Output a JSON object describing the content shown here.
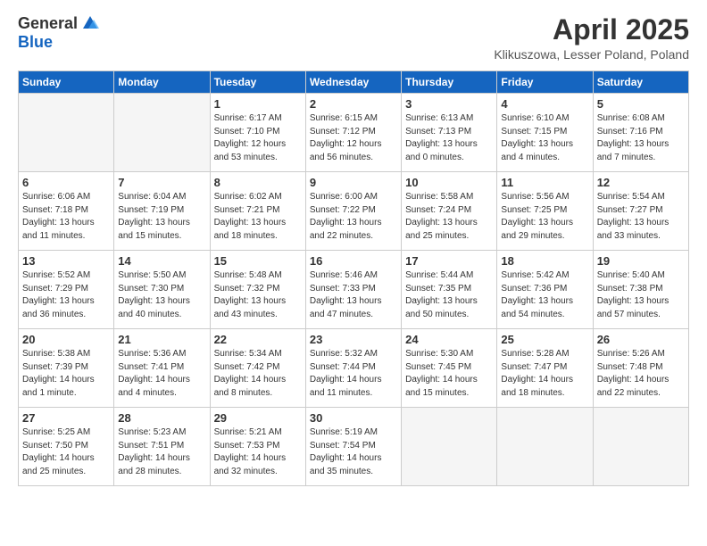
{
  "header": {
    "logo_general": "General",
    "logo_blue": "Blue",
    "title": "April 2025",
    "subtitle": "Klikuszowa, Lesser Poland, Poland"
  },
  "weekdays": [
    "Sunday",
    "Monday",
    "Tuesday",
    "Wednesday",
    "Thursday",
    "Friday",
    "Saturday"
  ],
  "weeks": [
    [
      {
        "day": "",
        "sunrise": "",
        "sunset": "",
        "daylight": ""
      },
      {
        "day": "",
        "sunrise": "",
        "sunset": "",
        "daylight": ""
      },
      {
        "day": "1",
        "sunrise": "Sunrise: 6:17 AM",
        "sunset": "Sunset: 7:10 PM",
        "daylight": "Daylight: 12 hours and 53 minutes."
      },
      {
        "day": "2",
        "sunrise": "Sunrise: 6:15 AM",
        "sunset": "Sunset: 7:12 PM",
        "daylight": "Daylight: 12 hours and 56 minutes."
      },
      {
        "day": "3",
        "sunrise": "Sunrise: 6:13 AM",
        "sunset": "Sunset: 7:13 PM",
        "daylight": "Daylight: 13 hours and 0 minutes."
      },
      {
        "day": "4",
        "sunrise": "Sunrise: 6:10 AM",
        "sunset": "Sunset: 7:15 PM",
        "daylight": "Daylight: 13 hours and 4 minutes."
      },
      {
        "day": "5",
        "sunrise": "Sunrise: 6:08 AM",
        "sunset": "Sunset: 7:16 PM",
        "daylight": "Daylight: 13 hours and 7 minutes."
      }
    ],
    [
      {
        "day": "6",
        "sunrise": "Sunrise: 6:06 AM",
        "sunset": "Sunset: 7:18 PM",
        "daylight": "Daylight: 13 hours and 11 minutes."
      },
      {
        "day": "7",
        "sunrise": "Sunrise: 6:04 AM",
        "sunset": "Sunset: 7:19 PM",
        "daylight": "Daylight: 13 hours and 15 minutes."
      },
      {
        "day": "8",
        "sunrise": "Sunrise: 6:02 AM",
        "sunset": "Sunset: 7:21 PM",
        "daylight": "Daylight: 13 hours and 18 minutes."
      },
      {
        "day": "9",
        "sunrise": "Sunrise: 6:00 AM",
        "sunset": "Sunset: 7:22 PM",
        "daylight": "Daylight: 13 hours and 22 minutes."
      },
      {
        "day": "10",
        "sunrise": "Sunrise: 5:58 AM",
        "sunset": "Sunset: 7:24 PM",
        "daylight": "Daylight: 13 hours and 25 minutes."
      },
      {
        "day": "11",
        "sunrise": "Sunrise: 5:56 AM",
        "sunset": "Sunset: 7:25 PM",
        "daylight": "Daylight: 13 hours and 29 minutes."
      },
      {
        "day": "12",
        "sunrise": "Sunrise: 5:54 AM",
        "sunset": "Sunset: 7:27 PM",
        "daylight": "Daylight: 13 hours and 33 minutes."
      }
    ],
    [
      {
        "day": "13",
        "sunrise": "Sunrise: 5:52 AM",
        "sunset": "Sunset: 7:29 PM",
        "daylight": "Daylight: 13 hours and 36 minutes."
      },
      {
        "day": "14",
        "sunrise": "Sunrise: 5:50 AM",
        "sunset": "Sunset: 7:30 PM",
        "daylight": "Daylight: 13 hours and 40 minutes."
      },
      {
        "day": "15",
        "sunrise": "Sunrise: 5:48 AM",
        "sunset": "Sunset: 7:32 PM",
        "daylight": "Daylight: 13 hours and 43 minutes."
      },
      {
        "day": "16",
        "sunrise": "Sunrise: 5:46 AM",
        "sunset": "Sunset: 7:33 PM",
        "daylight": "Daylight: 13 hours and 47 minutes."
      },
      {
        "day": "17",
        "sunrise": "Sunrise: 5:44 AM",
        "sunset": "Sunset: 7:35 PM",
        "daylight": "Daylight: 13 hours and 50 minutes."
      },
      {
        "day": "18",
        "sunrise": "Sunrise: 5:42 AM",
        "sunset": "Sunset: 7:36 PM",
        "daylight": "Daylight: 13 hours and 54 minutes."
      },
      {
        "day": "19",
        "sunrise": "Sunrise: 5:40 AM",
        "sunset": "Sunset: 7:38 PM",
        "daylight": "Daylight: 13 hours and 57 minutes."
      }
    ],
    [
      {
        "day": "20",
        "sunrise": "Sunrise: 5:38 AM",
        "sunset": "Sunset: 7:39 PM",
        "daylight": "Daylight: 14 hours and 1 minute."
      },
      {
        "day": "21",
        "sunrise": "Sunrise: 5:36 AM",
        "sunset": "Sunset: 7:41 PM",
        "daylight": "Daylight: 14 hours and 4 minutes."
      },
      {
        "day": "22",
        "sunrise": "Sunrise: 5:34 AM",
        "sunset": "Sunset: 7:42 PM",
        "daylight": "Daylight: 14 hours and 8 minutes."
      },
      {
        "day": "23",
        "sunrise": "Sunrise: 5:32 AM",
        "sunset": "Sunset: 7:44 PM",
        "daylight": "Daylight: 14 hours and 11 minutes."
      },
      {
        "day": "24",
        "sunrise": "Sunrise: 5:30 AM",
        "sunset": "Sunset: 7:45 PM",
        "daylight": "Daylight: 14 hours and 15 minutes."
      },
      {
        "day": "25",
        "sunrise": "Sunrise: 5:28 AM",
        "sunset": "Sunset: 7:47 PM",
        "daylight": "Daylight: 14 hours and 18 minutes."
      },
      {
        "day": "26",
        "sunrise": "Sunrise: 5:26 AM",
        "sunset": "Sunset: 7:48 PM",
        "daylight": "Daylight: 14 hours and 22 minutes."
      }
    ],
    [
      {
        "day": "27",
        "sunrise": "Sunrise: 5:25 AM",
        "sunset": "Sunset: 7:50 PM",
        "daylight": "Daylight: 14 hours and 25 minutes."
      },
      {
        "day": "28",
        "sunrise": "Sunrise: 5:23 AM",
        "sunset": "Sunset: 7:51 PM",
        "daylight": "Daylight: 14 hours and 28 minutes."
      },
      {
        "day": "29",
        "sunrise": "Sunrise: 5:21 AM",
        "sunset": "Sunset: 7:53 PM",
        "daylight": "Daylight: 14 hours and 32 minutes."
      },
      {
        "day": "30",
        "sunrise": "Sunrise: 5:19 AM",
        "sunset": "Sunset: 7:54 PM",
        "daylight": "Daylight: 14 hours and 35 minutes."
      },
      {
        "day": "",
        "sunrise": "",
        "sunset": "",
        "daylight": ""
      },
      {
        "day": "",
        "sunrise": "",
        "sunset": "",
        "daylight": ""
      },
      {
        "day": "",
        "sunrise": "",
        "sunset": "",
        "daylight": ""
      }
    ]
  ]
}
